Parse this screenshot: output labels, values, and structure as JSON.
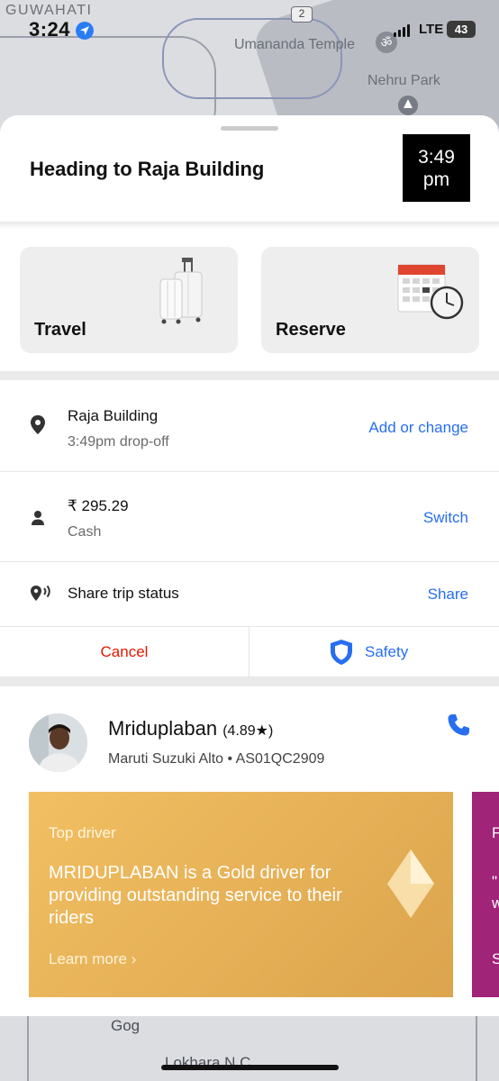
{
  "status": {
    "time": "3:24",
    "network": "LTE",
    "battery": "43"
  },
  "map": {
    "city": "GUWAHATI",
    "route_badge": "2",
    "landmarks": [
      "Umananda Temple",
      "Nehru Park",
      "Gog",
      "Lokhara N.C."
    ]
  },
  "header": {
    "title": "Heading to Raja Building",
    "eta_time": "3:49",
    "eta_period": "pm"
  },
  "cards": {
    "travel": "Travel",
    "reserve": "Reserve"
  },
  "trip": {
    "destination": "Raja Building",
    "dropoff": "3:49pm drop-off",
    "destination_action": "Add or change",
    "fare": "₹ 295.29",
    "payment": "Cash",
    "payment_action": "Switch",
    "share_label": "Share trip status",
    "share_action": "Share"
  },
  "actions": {
    "cancel": "Cancel",
    "safety": "Safety"
  },
  "driver": {
    "name": "Mriduplaban",
    "rating": "(4.89★)",
    "vehicle": "Maruti Suzuki Alto • AS01QC2909"
  },
  "promo": {
    "kicker": "Top driver",
    "body": "MRIDUPLABAN is a Gold driver for providing outstanding service to their riders",
    "link": "Learn more ›"
  },
  "promo_next": {
    "line1": "F",
    "line2": "\"",
    "line3": "w",
    "line4": "S"
  },
  "colors": {
    "accent_blue": "#276ef1",
    "cancel_red": "#e11900",
    "gold": "#e5b058",
    "magenta": "#a02478"
  }
}
